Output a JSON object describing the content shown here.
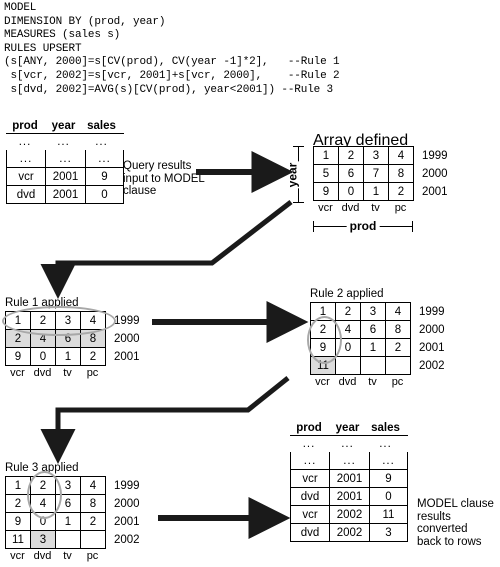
{
  "code": {
    "lines": "MODEL\nDIMENSION BY (prod, year)\nMEASURES (sales s)\nRULES UPSERT\n(s[ANY, 2000]=s[CV(prod), CV(year -1]*2],   --Rule 1\n s[vcr, 2002]=s[vcr, 2001]+s[vcr, 2000],    --Rule 2\n s[dvd, 2002]=AVG(s)[CV(prod), year<2001]) --Rule 3"
  },
  "input_table": {
    "headers": [
      "prod",
      "year",
      "sales"
    ],
    "ellipsis_row": [
      "...",
      "...",
      "..."
    ],
    "rows": [
      [
        "...",
        "...",
        "..."
      ],
      [
        "vcr",
        "2001",
        "9"
      ],
      [
        "dvd",
        "2001",
        "0"
      ]
    ]
  },
  "notes": {
    "input": "Query results\ninput to MODEL\nclause",
    "output": "MODEL clause\nresults\nconverted\nback to rows"
  },
  "array_defined": {
    "title": "Array defined",
    "col_labels": [
      "vcr",
      "dvd",
      "tv",
      "pc"
    ],
    "row_labels": [
      "1999",
      "2000",
      "2001"
    ],
    "rows": [
      [
        "1",
        "2",
        "3",
        "4"
      ],
      [
        "5",
        "6",
        "7",
        "8"
      ],
      [
        "9",
        "0",
        "1",
        "2"
      ]
    ],
    "x_axis_label": "prod",
    "y_axis_label": "year"
  },
  "rule1": {
    "title": "Rule 1 applied",
    "col_labels": [
      "vcr",
      "dvd",
      "tv",
      "pc"
    ],
    "row_labels": [
      "1999",
      "2000",
      "2001"
    ],
    "rows": [
      [
        "1",
        "2",
        "3",
        "4"
      ],
      [
        "2",
        "4",
        "6",
        "8"
      ],
      [
        "9",
        "0",
        "1",
        "2"
      ]
    ],
    "shaded": [
      [
        1,
        0
      ],
      [
        1,
        1
      ],
      [
        1,
        2
      ],
      [
        1,
        3
      ]
    ]
  },
  "rule2": {
    "title": "Rule 2 applied",
    "col_labels": [
      "vcr",
      "dvd",
      "tv",
      "pc"
    ],
    "row_labels": [
      "1999",
      "2000",
      "2001",
      "2002"
    ],
    "rows": [
      [
        "1",
        "2",
        "3",
        "4"
      ],
      [
        "2",
        "4",
        "6",
        "8"
      ],
      [
        "9",
        "0",
        "1",
        "2"
      ],
      [
        "11",
        "",
        "",
        ""
      ]
    ],
    "shaded": [
      [
        3,
        0
      ]
    ]
  },
  "rule3": {
    "title": "Rule 3 applied",
    "col_labels": [
      "vcr",
      "dvd",
      "tv",
      "pc"
    ],
    "row_labels": [
      "1999",
      "2000",
      "2001",
      "2002"
    ],
    "rows": [
      [
        "1",
        "2",
        "3",
        "4"
      ],
      [
        "2",
        "4",
        "6",
        "8"
      ],
      [
        "9",
        "0",
        "1",
        "2"
      ],
      [
        "11",
        "3",
        "",
        ""
      ]
    ],
    "shaded": [
      [
        3,
        1
      ]
    ]
  },
  "output_table": {
    "headers": [
      "prod",
      "year",
      "sales"
    ],
    "ellipsis_row": [
      "...",
      "...",
      "..."
    ],
    "rows": [
      [
        "...",
        "...",
        "..."
      ],
      [
        "vcr",
        "2001",
        "9"
      ],
      [
        "dvd",
        "2001",
        "0"
      ],
      [
        "vcr",
        "2002",
        "11"
      ],
      [
        "dvd",
        "2002",
        "3"
      ]
    ]
  },
  "colors": {
    "shade": "#dcdcdc",
    "oval": "#a8a8a8",
    "line": "#1a1a1a"
  }
}
